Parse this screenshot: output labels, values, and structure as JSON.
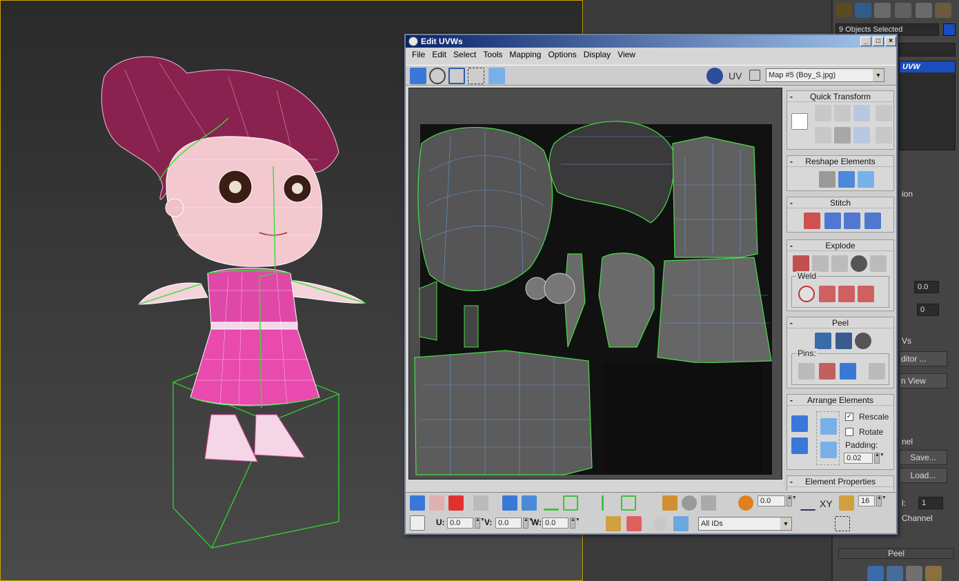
{
  "uvw_window": {
    "title": "Edit UVWs",
    "controls": {
      "minimize": "_",
      "maximize": "□",
      "close": "×"
    },
    "menu": [
      "File",
      "Edit",
      "Select",
      "Tools",
      "Mapping",
      "Options",
      "Display",
      "View"
    ],
    "uv_label": "UV",
    "map_select": "Map #5 (Boy_S.jpg)"
  },
  "sidebar": {
    "quick_transform": "Quick Transform",
    "reshape_elements": "Reshape Elements",
    "stitch": "Stitch",
    "explode": "Explode",
    "weld": "Weld",
    "peel": "Peel",
    "pins": "Pins:",
    "arrange_elements": "Arrange Elements",
    "rescale": "Rescale",
    "rotate": "Rotate",
    "padding_label": "Padding:",
    "padding_value": "0.02",
    "element_properties": "Element Properties"
  },
  "bottom_bar": {
    "u_label": "U:",
    "u_value": "0.0",
    "v_label": "V:",
    "v_value": "0.0",
    "w_label": "W:",
    "w_value": "0.0",
    "soft_value": "0.0",
    "xy_label": "XY",
    "grid_value": "16",
    "ids_select": "All IDs"
  },
  "command_panel": {
    "selection": "9 Objects Selected",
    "modifier": "UVW",
    "section_ion": "ion",
    "field1": "0.0",
    "field2": "0",
    "vs": "Vs",
    "editor": "ditor ...",
    "view": "n View",
    "channel_header": "nel",
    "save": "Save...",
    "load": "Load...",
    "channel_field_label": "l:",
    "channel_value": "1",
    "channel": "Channel",
    "peel": "Peel"
  }
}
